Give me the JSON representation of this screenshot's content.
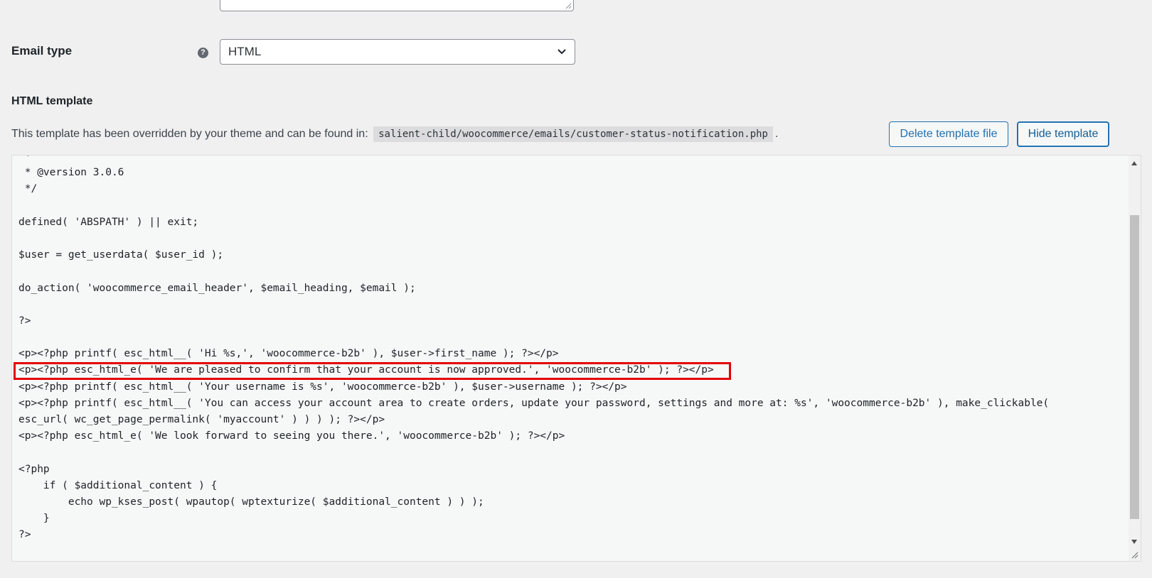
{
  "email_type": {
    "label": "Email type",
    "help_icon": "question-icon",
    "help_glyph": "?",
    "selected": "HTML",
    "chevron_icon": "chevron-down-icon"
  },
  "template": {
    "section_title": "HTML template",
    "override_prefix": "This template has been overridden by your theme and can be found in:",
    "path": "salient-child/woocommerce/emails/customer-status-notification.php",
    "override_suffix": ".",
    "delete_button": "Delete template file",
    "hide_button": "Hide template"
  },
  "code_lines": [
    " *",
    " * @version 3.0.6",
    " */",
    "",
    "defined( 'ABSPATH' ) || exit;",
    "",
    "$user = get_userdata( $user_id );",
    "",
    "do_action( 'woocommerce_email_header', $email_heading, $email );",
    "",
    "?>",
    "",
    "<p><?php printf( esc_html__( 'Hi %s,', 'woocommerce-b2b' ), $user->first_name ); ?></p>",
    "<p><?php esc_html_e( 'We are pleased to confirm that your account is now approved.', 'woocommerce-b2b' ); ?></p>",
    "<p><?php printf( esc_html__( 'Your username is %s', 'woocommerce-b2b' ), $user->username ); ?></p>",
    "<p><?php printf( esc_html__( 'You can access your account area to create orders, update your password, settings and more at: %s', 'woocommerce-b2b' ), make_clickable(",
    "esc_url( wc_get_page_permalink( 'myaccount' ) ) ) ); ?></p>",
    "<p><?php esc_html_e( 'We look forward to seeing you there.', 'woocommerce-b2b' ); ?></p>",
    "",
    "<?php",
    "    if ( $additional_content ) {",
    "        echo wp_kses_post( wpautop( wptexturize( $additional_content ) ) );",
    "    }",
    "?>"
  ],
  "highlight": {
    "line_index": 13,
    "color": "#e40000"
  },
  "colors": {
    "accent": "#2271b1",
    "background": "#f0f0f1",
    "editor_bg": "#f6f7f7"
  }
}
